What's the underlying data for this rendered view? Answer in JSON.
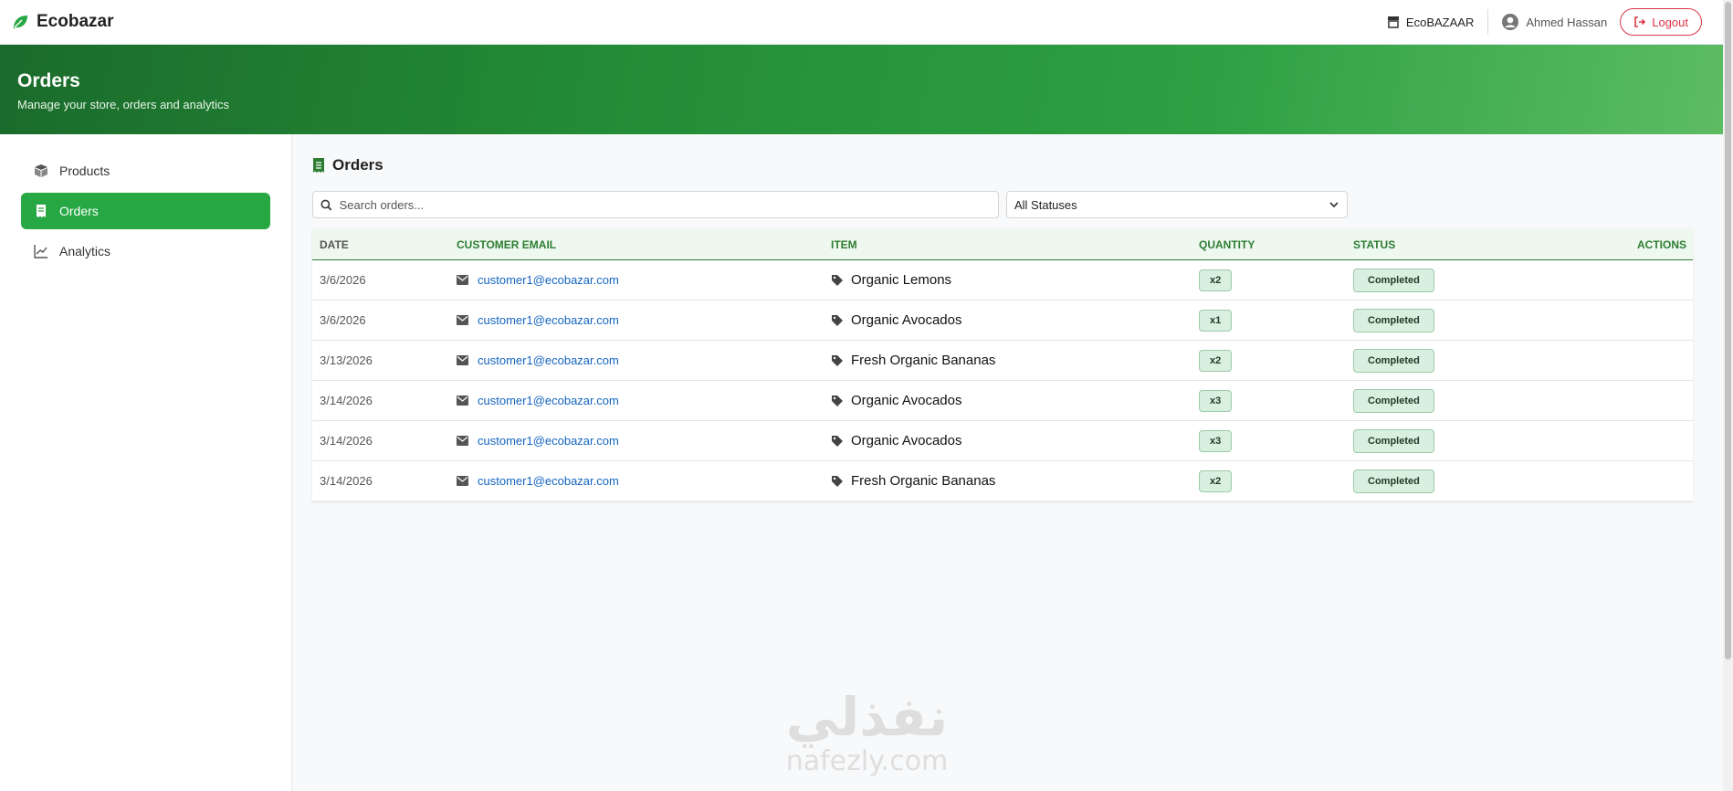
{
  "brand": {
    "name": "Ecobazar"
  },
  "topbar": {
    "store_label": "EcoBAZAAR",
    "user_name": "Ahmed Hassan",
    "logout_label": "Logout"
  },
  "hero": {
    "title": "Orders",
    "subtitle": "Manage your store, orders and analytics"
  },
  "sidebar": {
    "items": [
      {
        "label": "Products",
        "icon": "box-icon",
        "active": false
      },
      {
        "label": "Orders",
        "icon": "receipt-icon",
        "active": true
      },
      {
        "label": "Analytics",
        "icon": "chart-line-icon",
        "active": false
      }
    ]
  },
  "main": {
    "title": "Orders",
    "search_placeholder": "Search orders...",
    "status_filter": "All Statuses"
  },
  "table": {
    "headers": {
      "date": "DATE",
      "email": "CUSTOMER EMAIL",
      "item": "ITEM",
      "quantity": "QUANTITY",
      "status": "STATUS",
      "actions": "ACTIONS"
    },
    "rows": [
      {
        "date": "3/6/2026",
        "email": "customer1@ecobazar.com",
        "item": "Organic Lemons",
        "quantity": "x2",
        "status": "Completed"
      },
      {
        "date": "3/6/2026",
        "email": "customer1@ecobazar.com",
        "item": "Organic Avocados",
        "quantity": "x1",
        "status": "Completed"
      },
      {
        "date": "3/13/2026",
        "email": "customer1@ecobazar.com",
        "item": "Fresh Organic Bananas",
        "quantity": "x2",
        "status": "Completed"
      },
      {
        "date": "3/14/2026",
        "email": "customer1@ecobazar.com",
        "item": "Organic Avocados",
        "quantity": "x3",
        "status": "Completed"
      },
      {
        "date": "3/14/2026",
        "email": "customer1@ecobazar.com",
        "item": "Organic Avocados",
        "quantity": "x3",
        "status": "Completed"
      },
      {
        "date": "3/14/2026",
        "email": "customer1@ecobazar.com",
        "item": "Fresh Organic Bananas",
        "quantity": "x2",
        "status": "Completed"
      }
    ]
  },
  "watermark": {
    "arabic": "نفذلي",
    "latin": "nafezly.com"
  },
  "colors": {
    "primary": "#28a745",
    "danger": "#dc3545",
    "link": "#1565c0",
    "header_text": "#2e7d32"
  }
}
